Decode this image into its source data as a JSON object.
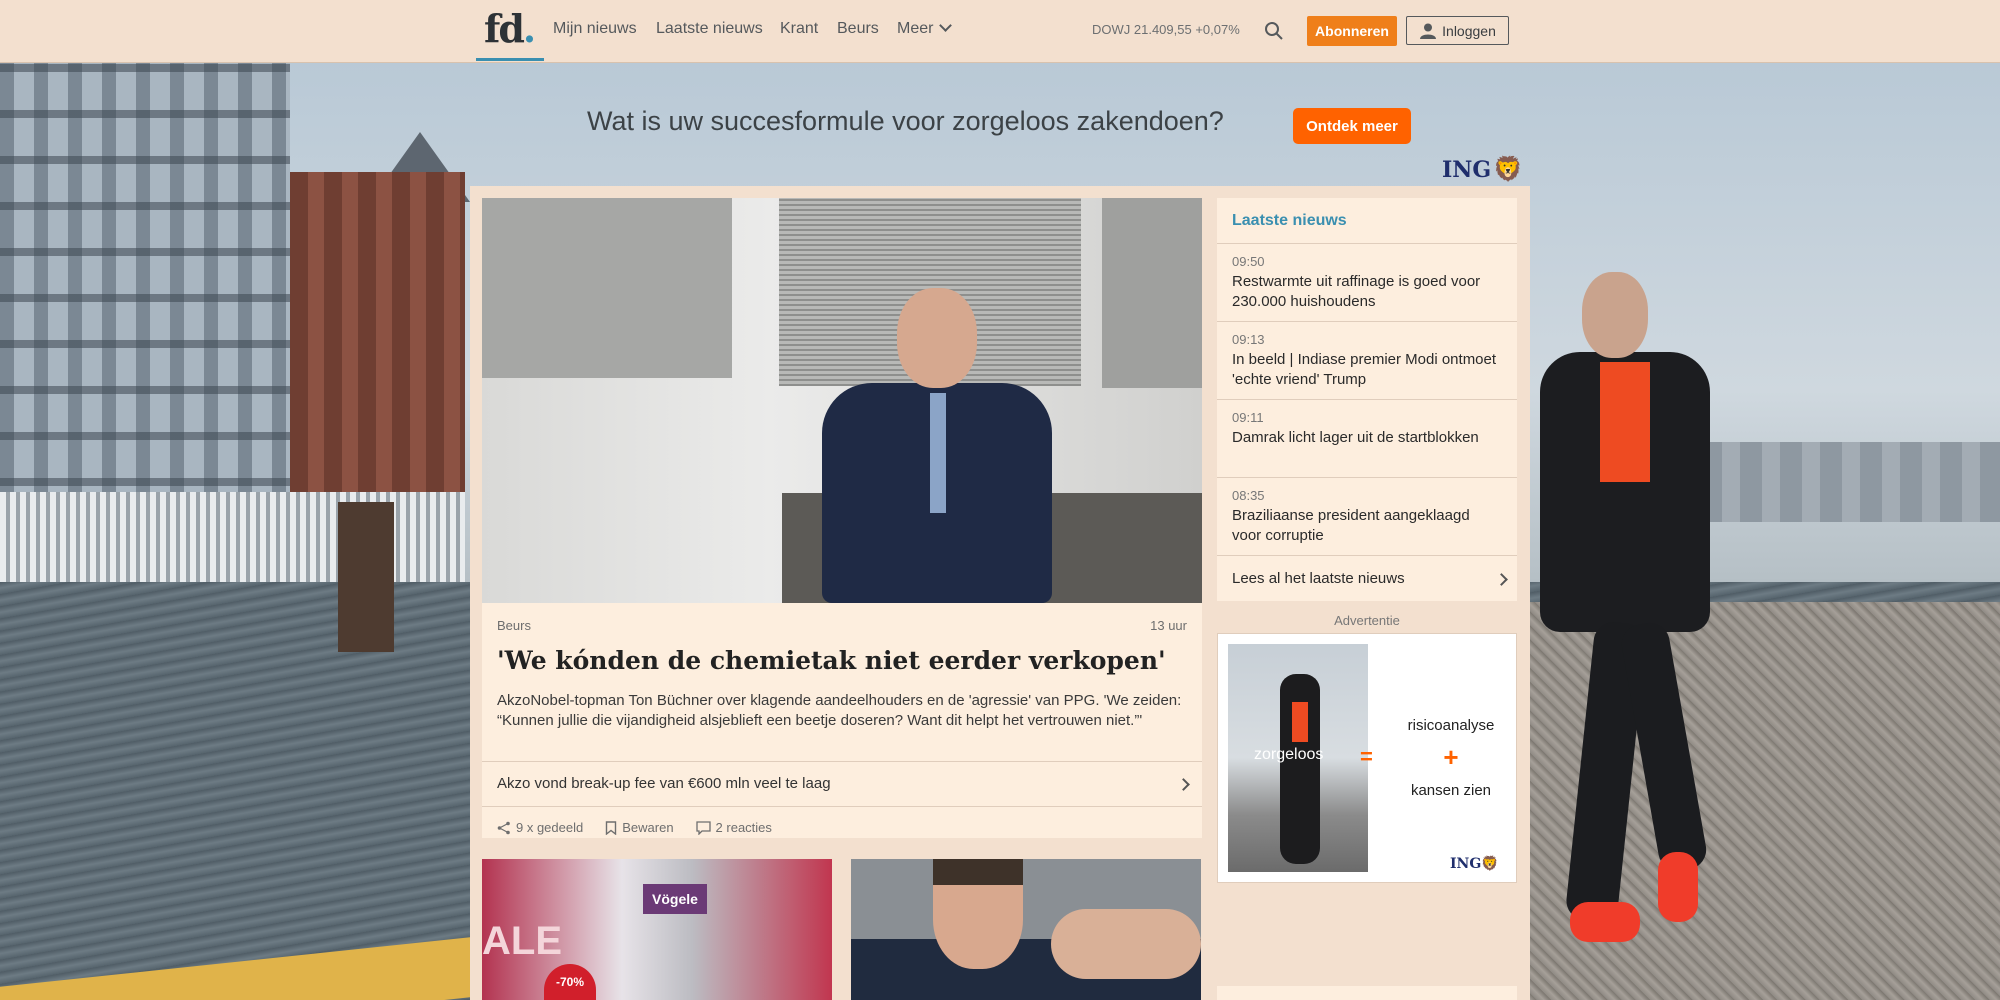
{
  "nav": {
    "logo_text": "fd",
    "logo_dot": ".",
    "items": [
      "Mijn nieuws",
      "Laatste nieuws",
      "Krant",
      "Beurs"
    ],
    "more_label": "Meer",
    "ticker": "DOWJ 21.409,55 +0,07%",
    "subscribe_label": "Abonneren",
    "login_label": "Inloggen"
  },
  "ad_banner": {
    "title": "Wat is uw succesformule voor zorgeloos zakendoen?",
    "cta_label": "Ontdek meer",
    "brand": "ING"
  },
  "hero": {
    "category": "Beurs",
    "time": "13 uur",
    "title": "'We kónden de chemietak niet eerder verkopen'",
    "intro": "AkzoNobel-topman Ton Büchner over klagende aandeelhouders en de 'agressie' van PPG. 'We zeiden: “Kunnen jullie die vijandigheid alsjeblieft een beetje doseren? Want dit helpt het vertrouwen niet.”'",
    "related": "Akzo vond break-up fee van €600 mln veel te laag",
    "shares": "9 x gedeeld",
    "save_label": "Bewaren",
    "comments": "2 reacties"
  },
  "latest": {
    "heading": "Laatste nieuws",
    "items": [
      {
        "time": "09:50",
        "text": "Restwarmte uit raffinage is goed voor 230.000 huishoudens"
      },
      {
        "time": "09:13",
        "text": "In beeld | Indiase premier Modi ontmoet 'echte vriend' Trump"
      },
      {
        "time": "09:11",
        "text": "Damrak licht lager uit de startblokken"
      },
      {
        "time": "08:35",
        "text": "Braziliaanse president aangeklaagd voor corruptie"
      }
    ],
    "all_label": "Lees al het laatste nieuws"
  },
  "advert": {
    "label": "Advertentie",
    "word_left": "zorgeloos",
    "equals": "=",
    "word_1": "risicoanalyse",
    "plus": "+",
    "word_2": "kansen zien",
    "brand": "ING"
  },
  "thumb_a": {
    "sign": "Vögele",
    "badge": "-70%",
    "sale": "ALE"
  },
  "colors": {
    "accent_blue": "#3a8fb0",
    "subscribe_orange": "#ef7f1a",
    "ing_orange": "#ff6200",
    "ing_navy": "#1f2e6c",
    "panel_bg": "#f3e0cf",
    "card_bg": "#fdeede"
  },
  "icons": [
    "search-icon",
    "user-icon",
    "chevron-down-icon",
    "share-icon",
    "bookmark-icon",
    "comment-icon",
    "chevron-right-icon",
    "ing-lion-icon"
  ]
}
